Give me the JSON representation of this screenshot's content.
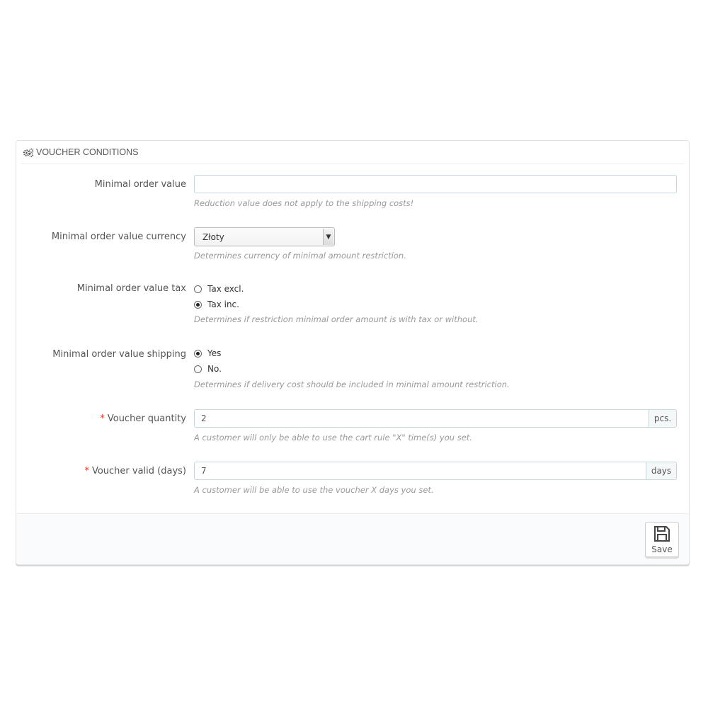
{
  "panel": {
    "title": "VOUCHER CONDITIONS",
    "icon": "cogs-icon"
  },
  "fields": {
    "minimal_order_value": {
      "label": "Minimal order value",
      "value": "",
      "help": "Reduction value does not apply to the shipping costs!"
    },
    "currency": {
      "label": "Minimal order value currency",
      "selected": "Złoty",
      "help": "Determines currency of minimal amount restriction."
    },
    "tax": {
      "label": "Minimal order value tax",
      "options": [
        {
          "label": "Tax excl.",
          "checked": false
        },
        {
          "label": "Tax inc.",
          "checked": true
        }
      ],
      "help": "Determines if restriction minimal order amount is with tax or without."
    },
    "shipping": {
      "label": "Minimal order value shipping",
      "options": [
        {
          "label": "Yes",
          "checked": true
        },
        {
          "label": "No.",
          "checked": false
        }
      ],
      "help": "Determines if delivery cost should be included in minimal amount restriction."
    },
    "voucher_quantity": {
      "required_mark": "*",
      "label": "Voucher quantity",
      "value": "2",
      "suffix": "pcs.",
      "help": "A customer will only be able to use the cart rule \"X\" time(s) you set."
    },
    "voucher_valid": {
      "required_mark": "*",
      "label": "Voucher valid (days)",
      "value": "7",
      "suffix": "days",
      "help": "A customer will be able to use the voucher X days you set."
    }
  },
  "footer": {
    "save_label": "Save",
    "save_icon": "floppy-disk-icon"
  }
}
